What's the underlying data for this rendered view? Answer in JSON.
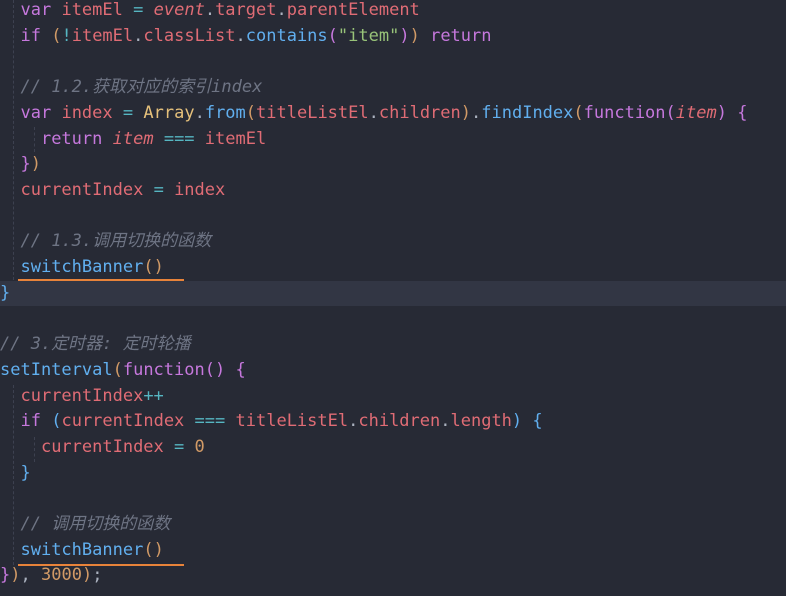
{
  "code_lines": [
    {
      "tokens": [
        {
          "t": "  "
        },
        {
          "t": "var",
          "c": "k"
        },
        {
          "t": " "
        },
        {
          "t": "itemEl",
          "c": "v"
        },
        {
          "t": " "
        },
        {
          "t": "=",
          "c": "o"
        },
        {
          "t": " "
        },
        {
          "t": "event",
          "c": "vi"
        },
        {
          "t": ".",
          "c": "pl"
        },
        {
          "t": "target",
          "c": "v"
        },
        {
          "t": ".",
          "c": "pl"
        },
        {
          "t": "parentElement",
          "c": "v"
        }
      ]
    },
    {
      "tokens": [
        {
          "t": "  "
        },
        {
          "t": "if",
          "c": "k"
        },
        {
          "t": " "
        },
        {
          "t": "(",
          "c": "b1"
        },
        {
          "t": "!",
          "c": "o"
        },
        {
          "t": "itemEl",
          "c": "v"
        },
        {
          "t": ".",
          "c": "pl"
        },
        {
          "t": "classList",
          "c": "v"
        },
        {
          "t": ".",
          "c": "pl"
        },
        {
          "t": "contains",
          "c": "f"
        },
        {
          "t": "(",
          "c": "b2"
        },
        {
          "t": "\"item\"",
          "c": "s"
        },
        {
          "t": ")",
          "c": "b2"
        },
        {
          "t": ")",
          "c": "b1"
        },
        {
          "t": " "
        },
        {
          "t": "return",
          "c": "k"
        }
      ]
    },
    {
      "tokens": []
    },
    {
      "tokens": [
        {
          "t": "  "
        },
        {
          "t": "// 1.2.获取对应的索引index",
          "c": "c"
        }
      ]
    },
    {
      "tokens": [
        {
          "t": "  "
        },
        {
          "t": "var",
          "c": "k"
        },
        {
          "t": " "
        },
        {
          "t": "index",
          "c": "v"
        },
        {
          "t": " "
        },
        {
          "t": "=",
          "c": "o"
        },
        {
          "t": " "
        },
        {
          "t": "Array",
          "c": "p"
        },
        {
          "t": ".",
          "c": "pl"
        },
        {
          "t": "from",
          "c": "f"
        },
        {
          "t": "(",
          "c": "b1"
        },
        {
          "t": "titleListEl",
          "c": "v"
        },
        {
          "t": ".",
          "c": "pl"
        },
        {
          "t": "children",
          "c": "v"
        },
        {
          "t": ")",
          "c": "b1"
        },
        {
          "t": ".",
          "c": "pl"
        },
        {
          "t": "findIndex",
          "c": "f"
        },
        {
          "t": "(",
          "c": "b1"
        },
        {
          "t": "function",
          "c": "k"
        },
        {
          "t": "(",
          "c": "b2"
        },
        {
          "t": "item",
          "c": "vi"
        },
        {
          "t": ")",
          "c": "b2"
        },
        {
          "t": " "
        },
        {
          "t": "{",
          "c": "b2"
        }
      ]
    },
    {
      "tokens": [
        {
          "t": "    "
        },
        {
          "t": "return",
          "c": "k"
        },
        {
          "t": " "
        },
        {
          "t": "item",
          "c": "vi"
        },
        {
          "t": " "
        },
        {
          "t": "===",
          "c": "o"
        },
        {
          "t": " "
        },
        {
          "t": "itemEl",
          "c": "v"
        }
      ]
    },
    {
      "tokens": [
        {
          "t": "  "
        },
        {
          "t": "}",
          "c": "b2"
        },
        {
          "t": ")",
          "c": "b1"
        }
      ]
    },
    {
      "tokens": [
        {
          "t": "  "
        },
        {
          "t": "currentIndex",
          "c": "v"
        },
        {
          "t": " "
        },
        {
          "t": "=",
          "c": "o"
        },
        {
          "t": " "
        },
        {
          "t": "index",
          "c": "v"
        }
      ]
    },
    {
      "tokens": []
    },
    {
      "tokens": [
        {
          "t": "  "
        },
        {
          "t": "// 1.3.调用切换的函数",
          "c": "c"
        }
      ]
    },
    {
      "tokens": [
        {
          "t": "  "
        },
        {
          "t": "switchBanner",
          "c": "f"
        },
        {
          "t": "(",
          "c": "b1"
        },
        {
          "t": ")",
          "c": "b1"
        }
      ]
    },
    {
      "tokens": [
        {
          "t": "}",
          "c": "b3"
        }
      ],
      "current": true
    },
    {
      "tokens": []
    },
    {
      "tokens": [
        {
          "t": "// 3.定时器: 定时轮播",
          "c": "c"
        }
      ]
    },
    {
      "tokens": [
        {
          "t": "setInterval",
          "c": "f"
        },
        {
          "t": "(",
          "c": "b1"
        },
        {
          "t": "function",
          "c": "k"
        },
        {
          "t": "(",
          "c": "b2"
        },
        {
          "t": ")",
          "c": "b2"
        },
        {
          "t": " "
        },
        {
          "t": "{",
          "c": "b2"
        }
      ]
    },
    {
      "tokens": [
        {
          "t": "  "
        },
        {
          "t": "currentIndex",
          "c": "v"
        },
        {
          "t": "++",
          "c": "o"
        }
      ]
    },
    {
      "tokens": [
        {
          "t": "  "
        },
        {
          "t": "if",
          "c": "k"
        },
        {
          "t": " "
        },
        {
          "t": "(",
          "c": "b3"
        },
        {
          "t": "currentIndex",
          "c": "v"
        },
        {
          "t": " "
        },
        {
          "t": "===",
          "c": "o"
        },
        {
          "t": " "
        },
        {
          "t": "titleListEl",
          "c": "v"
        },
        {
          "t": ".",
          "c": "pl"
        },
        {
          "t": "children",
          "c": "v"
        },
        {
          "t": ".",
          "c": "pl"
        },
        {
          "t": "length",
          "c": "v"
        },
        {
          "t": ")",
          "c": "b3"
        },
        {
          "t": " "
        },
        {
          "t": "{",
          "c": "b3"
        }
      ]
    },
    {
      "tokens": [
        {
          "t": "    "
        },
        {
          "t": "currentIndex",
          "c": "v"
        },
        {
          "t": " "
        },
        {
          "t": "=",
          "c": "o"
        },
        {
          "t": " "
        },
        {
          "t": "0",
          "c": "n"
        }
      ]
    },
    {
      "tokens": [
        {
          "t": "  "
        },
        {
          "t": "}",
          "c": "b3"
        }
      ]
    },
    {
      "tokens": []
    },
    {
      "tokens": [
        {
          "t": "  "
        },
        {
          "t": "// 调用切换的函数",
          "c": "c"
        }
      ]
    },
    {
      "tokens": [
        {
          "t": "  "
        },
        {
          "t": "switchBanner",
          "c": "f"
        },
        {
          "t": "(",
          "c": "b1"
        },
        {
          "t": ")",
          "c": "b1"
        }
      ]
    },
    {
      "tokens": [
        {
          "t": "}",
          "c": "b2"
        },
        {
          "t": ")",
          "c": "b1"
        },
        {
          "t": ", ",
          "c": "pl"
        },
        {
          "t": "3000",
          "c": "n"
        },
        {
          "t": ")",
          "c": "b1"
        },
        {
          "t": ";",
          "c": "pl"
        }
      ]
    }
  ],
  "theme": {
    "background": "#272a35",
    "current_line": "#323644",
    "underline": "#e8833a"
  }
}
